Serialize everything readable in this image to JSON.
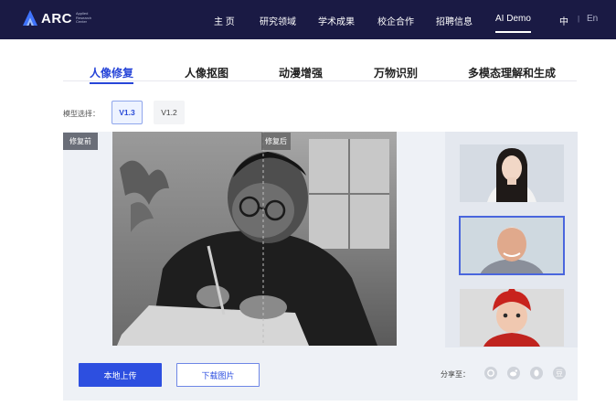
{
  "brand": {
    "logo_text": "ARC",
    "subtitle": "Applied Research Center",
    "accent": "#2d4fe0",
    "nav_bg": "#1a1a44"
  },
  "nav": {
    "items": [
      {
        "label": "主 页"
      },
      {
        "label": "研究领域"
      },
      {
        "label": "学术成果"
      },
      {
        "label": "校企合作"
      },
      {
        "label": "招聘信息"
      },
      {
        "label": "AI Demo",
        "active": true
      }
    ],
    "lang_zh": "中",
    "lang_sep": "|",
    "lang_en": "En"
  },
  "tabs": [
    {
      "label": "人像修复",
      "active": true
    },
    {
      "label": "人像抠图"
    },
    {
      "label": "动漫增强"
    },
    {
      "label": "万物识别"
    },
    {
      "label": "多模态理解和生成"
    }
  ],
  "model": {
    "label": "模型选择：",
    "versions": [
      {
        "label": "V1.3",
        "selected": true
      },
      {
        "label": "V1.2"
      }
    ]
  },
  "preview": {
    "before_label": "修复前",
    "after_label": "修复后"
  },
  "samples": [
    {
      "icon": "young-woman-portrait",
      "selected": false
    },
    {
      "icon": "older-man-portrait",
      "selected": true
    },
    {
      "icon": "child-red-hat-portrait",
      "selected": false
    }
  ],
  "actions": {
    "upload": "本地上传",
    "download": "下载图片"
  },
  "share": {
    "label": "分享至：",
    "icons": [
      "moments-icon",
      "weibo-icon",
      "qq-icon",
      "douban-icon"
    ],
    "douban_glyph": "豆"
  }
}
